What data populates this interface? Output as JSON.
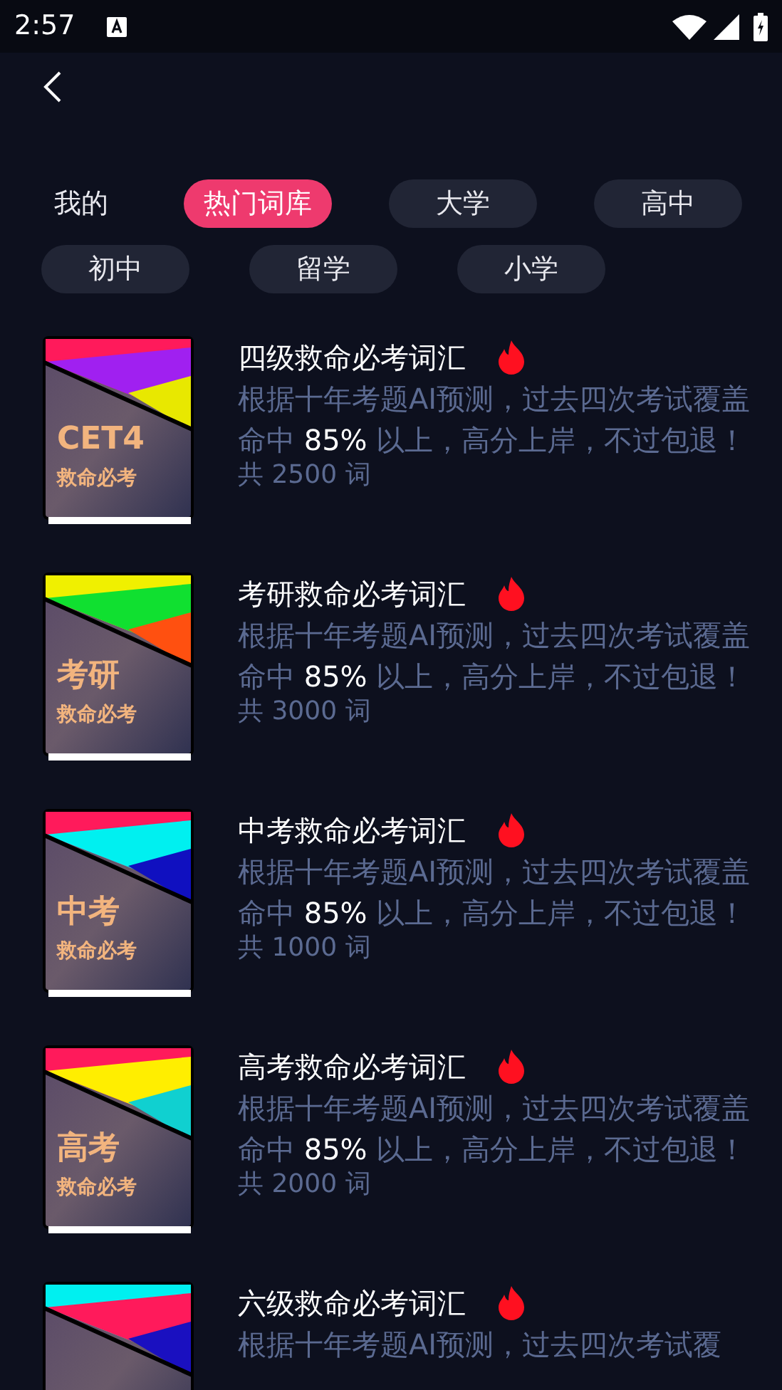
{
  "status_bar": {
    "time": "2:57"
  },
  "tabs": [
    {
      "label": "我的",
      "selected": false,
      "kind": "plain"
    },
    {
      "label": "热门词库",
      "selected": true,
      "kind": "pill"
    },
    {
      "label": "大学",
      "selected": false,
      "kind": "pill"
    },
    {
      "label": "高中",
      "selected": false,
      "kind": "pill"
    },
    {
      "label": "初中",
      "selected": false,
      "kind": "pill"
    },
    {
      "label": "留学",
      "selected": false,
      "kind": "pill"
    },
    {
      "label": "小学",
      "selected": false,
      "kind": "pill"
    }
  ],
  "books": [
    {
      "title": "四级救命必考词汇",
      "cover_title": "CET4",
      "cover_subtitle": "救命必考",
      "desc_before": "根据十年考题AI预测，过去四次考试覆盖命中 ",
      "highlight": "85%",
      "desc_after": " 以上，高分上岸，不过包退！",
      "count": "共 2500 词"
    },
    {
      "title": "考研救命必考词汇",
      "cover_title": "考研",
      "cover_subtitle": "救命必考",
      "desc_before": "根据十年考题AI预测，过去四次考试覆盖命中 ",
      "highlight": "85%",
      "desc_after": " 以上，高分上岸，不过包退！",
      "count": "共 3000 词"
    },
    {
      "title": "中考救命必考词汇",
      "cover_title": "中考",
      "cover_subtitle": "救命必考",
      "desc_before": "根据十年考题AI预测，过去四次考试覆盖命中 ",
      "highlight": "85%",
      "desc_after": " 以上，高分上岸，不过包退！",
      "count": "共 1000 词"
    },
    {
      "title": "高考救命必考词汇",
      "cover_title": "高考",
      "cover_subtitle": "救命必考",
      "desc_before": "根据十年考题AI预测，过去四次考试覆盖命中 ",
      "highlight": "85%",
      "desc_after": " 以上，高分上岸，不过包退！",
      "count": "共 2000 词"
    },
    {
      "title": "六级救命必考词汇",
      "desc_before": "根据十年考题AI预测，过去四次考试覆"
    }
  ]
}
